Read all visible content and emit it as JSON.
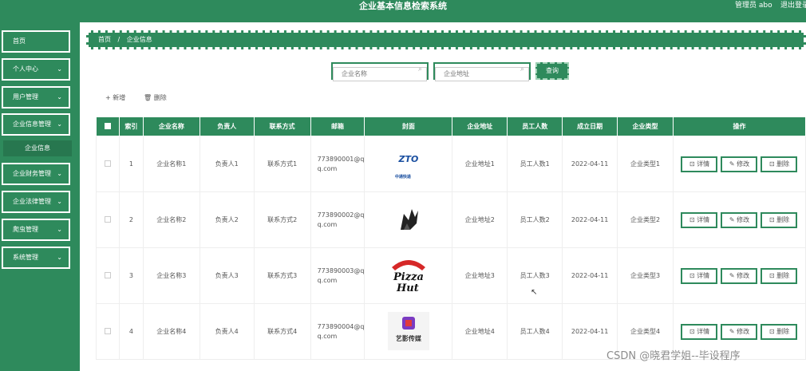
{
  "app": {
    "title": "企业基本信息检索系统",
    "admin": "管理员 abo",
    "logout": "退出登录"
  },
  "sidebar": {
    "items": [
      {
        "label": "首页",
        "chevron": ""
      },
      {
        "label": "个人中心",
        "chevron": "⌄"
      },
      {
        "label": "用户管理",
        "chevron": "⌄"
      },
      {
        "label": "企业信息管理",
        "chevron": "⌄"
      },
      {
        "label": "企业财务管理",
        "chevron": "⌄"
      },
      {
        "label": "企业法律管理",
        "chevron": "⌄"
      },
      {
        "label": "爬虫管理",
        "chevron": "⌄"
      },
      {
        "label": "系统管理",
        "chevron": "⌄"
      }
    ],
    "subitem": "企业信息"
  },
  "breadcrumb": {
    "home": "首页",
    "sep": "/",
    "current": "企业信息"
  },
  "search": {
    "name_placeholder": "企业名称",
    "address_placeholder": "企业地址",
    "query_label": "查询"
  },
  "actions": {
    "add": "+ 新增",
    "delete": "🗑 删除"
  },
  "table": {
    "headers": [
      "索引",
      "企业名称",
      "负责人",
      "联系方式",
      "邮箱",
      "封面",
      "企业地址",
      "员工人数",
      "成立日期",
      "企业类型",
      "操作"
    ],
    "rows": [
      {
        "index": "1",
        "name": "企业名称1",
        "leader": "负责人1",
        "contact": "联系方式1",
        "email": "773890001@qq.com",
        "logo": "zto-logo",
        "address": "企业地址1",
        "staff": "员工人数1",
        "date": "2022-04-11",
        "type": "企业类型1"
      },
      {
        "index": "2",
        "name": "企业名称2",
        "leader": "负责人2",
        "contact": "联系方式2",
        "email": "773890002@qq.com",
        "logo": "fox-logo",
        "address": "企业地址2",
        "staff": "员工人数2",
        "date": "2022-04-11",
        "type": "企业类型2"
      },
      {
        "index": "3",
        "name": "企业名称3",
        "leader": "负责人3",
        "contact": "联系方式3",
        "email": "773890003@qq.com",
        "logo": "pizza-hut-logo",
        "address": "企业地址3",
        "staff": "员工人数3",
        "date": "2022-04-11",
        "type": "企业类型3"
      },
      {
        "index": "4",
        "name": "企业名称4",
        "leader": "负责人4",
        "contact": "联系方式4",
        "email": "773890004@qq.com",
        "logo": "yiying-logo",
        "address": "企业地址4",
        "staff": "员工人数4",
        "date": "2022-04-11",
        "type": "企业类型4"
      }
    ],
    "ops": {
      "detail": "⊡ 详情",
      "edit": "✎ 修改",
      "delete": "⊡ 删除"
    }
  },
  "logos": {
    "zto_text": "ZTO",
    "zto_sub": "中通快递",
    "yiying_text": "艺影传媒"
  },
  "watermark": "CSDN @晓君学姐--毕设程序",
  "colors": {
    "primary": "#2e8a5c",
    "white": "#ffffff"
  }
}
